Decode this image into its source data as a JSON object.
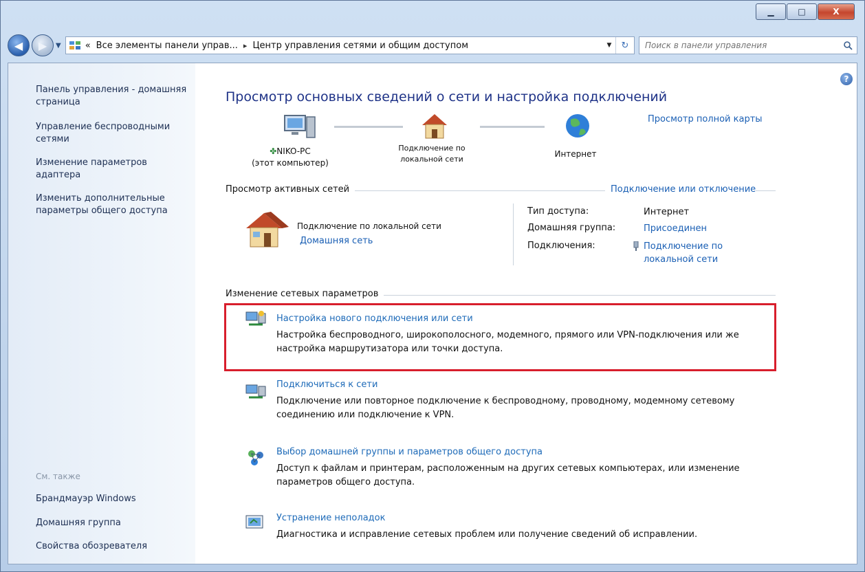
{
  "window": {
    "caption_minimize": "▁",
    "caption_maximize": "□",
    "caption_close": "X"
  },
  "addressbar": {
    "breadcrumb": [
      "«",
      "Все элементы панели управ...",
      "▸",
      "Центр управления сетями и общим доступом"
    ],
    "search_placeholder": "Поиск в панели управления"
  },
  "sidebar": {
    "links": [
      "Панель управления - домашняя страница",
      "Управление беспроводными сетями",
      "Изменение параметров адаптера",
      "Изменить дополнительные параметры общего доступа"
    ],
    "see_also_label": "См. также",
    "see_also_links": [
      "Брандмауэр Windows",
      "Домашняя группа",
      "Свойства обозревателя"
    ]
  },
  "main": {
    "title": "Просмотр основных сведений о сети и настройка подключений",
    "full_map_link": "Просмотр полной карты",
    "map": {
      "computer_name": "NIKO-PC",
      "computer_sub": "(этот компьютер)",
      "network_label": "Подключение по локальной сети",
      "internet_label": "Интернет"
    },
    "active_networks": {
      "title": "Просмотр активных сетей",
      "connect_link": "Подключение или отключение",
      "network_name": "Подключение по локальной сети",
      "network_type": "Домашняя сеть",
      "access_type_label": "Тип доступа:",
      "access_type_value": "Интернет",
      "homegroup_label": "Домашняя группа:",
      "homegroup_value": "Присоединен",
      "connections_label": "Подключения:",
      "connections_value": "Подключение по локальной сети"
    },
    "change_settings": {
      "title": "Изменение сетевых параметров",
      "tasks": [
        {
          "title": "Настройка нового подключения или сети",
          "desc": "Настройка беспроводного, широкополосного, модемного, прямого или VPN-подключения или же настройка маршрутизатора или точки доступа."
        },
        {
          "title": "Подключиться к сети",
          "desc": "Подключение или повторное подключение к беспроводному, проводному, модемному сетевому соединению или подключение к VPN."
        },
        {
          "title": "Выбор домашней группы и параметров общего доступа",
          "desc": "Доступ к файлам и принтерам, расположенным на других сетевых компьютерах, или изменение параметров общего доступа."
        },
        {
          "title": "Устранение неполадок",
          "desc": "Диагностика и исправление сетевых проблем или получение сведений об исправлении."
        }
      ]
    }
  }
}
